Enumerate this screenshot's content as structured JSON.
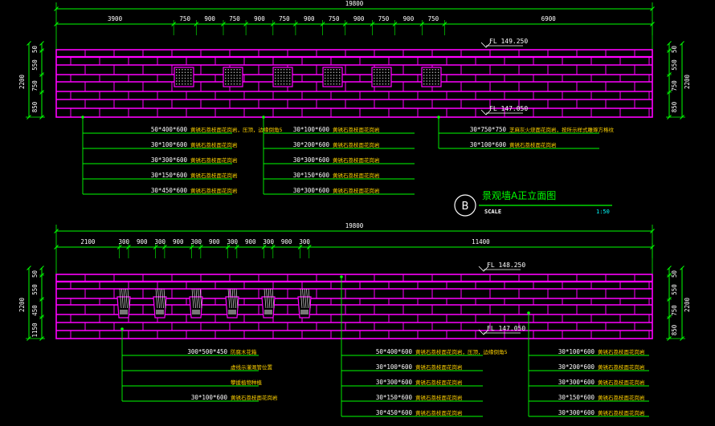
{
  "colors": {
    "background": "#000000",
    "dimension_line": "#00ff00",
    "wall_brick": "#ff00ff",
    "text": "#ffffff",
    "chinese_note": "#ffd200",
    "scale_value": "#00ffff"
  },
  "elevation_a": {
    "total_dim": "19800",
    "segment_dims": [
      "3900",
      "750",
      "900",
      "750",
      "900",
      "750",
      "900",
      "750",
      "900",
      "750",
      "900",
      "750",
      "6900"
    ],
    "left_height_dims": [
      "50",
      "550",
      "750",
      "850"
    ],
    "left_total": "2200",
    "right_height_dims": [
      "50",
      "550",
      "750",
      "850"
    ],
    "right_total": "2200",
    "fl_top": "FL 149.250",
    "fl_bottom": "FL 147.050",
    "callout_groups": [
      {
        "lines": [
          {
            "code": "50*400*600",
            "note": "黄锈石荔枝面花岗岩，压顶，边缘倒角5"
          },
          {
            "code": "30*100*600",
            "note": "黄锈石荔枝面花岗岩"
          },
          {
            "code": "30*300*600",
            "note": "黄锈石荔枝面花岗岩"
          },
          {
            "code": "30*150*600",
            "note": "黄锈石荔枝面花岗岩"
          },
          {
            "code": "30*450*600",
            "note": "黄锈石荔枝面花岗岩"
          }
        ]
      },
      {
        "lines": [
          {
            "code": "30*100*600",
            "note": "黄锈石荔枝面花岗岩"
          },
          {
            "code": "30*200*600",
            "note": "黄锈石荔枝面花岗岩"
          },
          {
            "code": "30*300*600",
            "note": "黄锈石荔枝面花岗岩"
          },
          {
            "code": "30*150*600",
            "note": "黄锈石荔枝面花岗岩"
          },
          {
            "code": "30*300*600",
            "note": "黄锈石荔枝面花岗岩"
          }
        ]
      },
      {
        "lines": [
          {
            "code": "30*750*750",
            "note": "芝麻灰火烧面花岗岩，按所示样式雕琢方格纹"
          },
          {
            "code": "30*100*600",
            "note": "黄锈石荔枝面花岗岩"
          }
        ]
      }
    ]
  },
  "title_block": {
    "badge": "B",
    "title": "景观墙A正立面图",
    "scale_label": "SCALE",
    "scale_value": "1:50"
  },
  "elevation_b": {
    "total_dim": "19800",
    "segment_dims": [
      "2100",
      "300",
      "900",
      "300",
      "900",
      "300",
      "900",
      "300",
      "900",
      "300",
      "900",
      "300",
      "11400"
    ],
    "left_height_dims": [
      "50",
      "550",
      "450",
      "1150"
    ],
    "left_total": "2200",
    "right_height_dims": [
      "50",
      "550",
      "750",
      "850"
    ],
    "right_total": "2200",
    "fl_top": "FL 148.250",
    "fl_bottom": "FL 147.050",
    "callout_groups": [
      {
        "lines": [
          {
            "code": "300*500*450",
            "note": "防腐木花箱"
          },
          {
            "code": "",
            "note": "虚线示灌溉管位置"
          },
          {
            "code": "",
            "note": "攀援植物种植"
          },
          {
            "code": "30*100*600",
            "note": "黄锈石荔枝面花岗岩"
          }
        ]
      },
      {
        "lines": [
          {
            "code": "50*400*600",
            "note": "黄锈石荔枝面花岗岩，压顶，边缘倒角5"
          },
          {
            "code": "30*100*600",
            "note": "黄锈石荔枝面花岗岩"
          },
          {
            "code": "30*300*600",
            "note": "黄锈石荔枝面花岗岩"
          },
          {
            "code": "30*150*600",
            "note": "黄锈石荔枝面花岗岩"
          },
          {
            "code": "30*450*600",
            "note": "黄锈石荔枝面花岗岩"
          }
        ]
      },
      {
        "lines": [
          {
            "code": "30*100*600",
            "note": "黄锈石荔枝面花岗岩"
          },
          {
            "code": "30*200*600",
            "note": "黄锈石荔枝面花岗岩"
          },
          {
            "code": "30*300*600",
            "note": "黄锈石荔枝面花岗岩"
          },
          {
            "code": "30*150*600",
            "note": "黄锈石荔枝面花岗岩"
          },
          {
            "code": "30*300*600",
            "note": "黄锈石荔枝面花岗岩"
          }
        ]
      }
    ]
  }
}
